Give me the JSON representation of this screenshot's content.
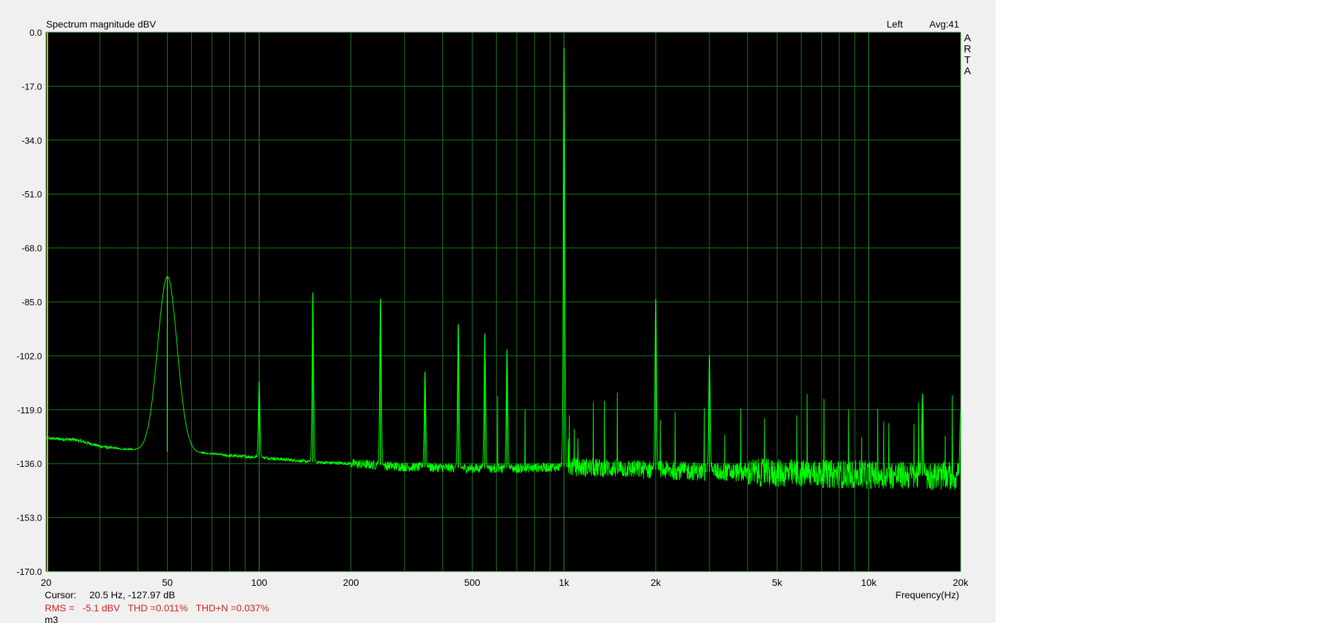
{
  "chart_data": {
    "type": "line",
    "title": "Spectrum magnitude dBV",
    "channel_label": "Left",
    "avg_label": "Avg:41",
    "brand": "ARTA",
    "xlabel": "Frequency(Hz)",
    "xscale": "log",
    "xlim": [
      20,
      20000
    ],
    "ylim": [
      -170,
      0
    ],
    "yticks": [
      0,
      -17,
      -34,
      -51,
      -68,
      -85,
      -102,
      -119,
      -136,
      -153,
      -170
    ],
    "ytick_labels": [
      "0.0",
      "-17.0",
      "-34.0",
      "-51.0",
      "-68.0",
      "-85.0",
      "-102.0",
      "-119.0",
      "-136.0",
      "-153.0",
      "-170.0"
    ],
    "xticks": [
      20,
      50,
      100,
      200,
      500,
      1000,
      2000,
      5000,
      10000,
      20000
    ],
    "xtick_labels": [
      "20",
      "50",
      "100",
      "200",
      "500",
      "1k",
      "2k",
      "5k",
      "10k",
      "20k"
    ],
    "grid": true,
    "series_color": "#00ff00",
    "background_color": "#000000",
    "grid_color": "#1f7a1f",
    "noise_floor": [
      [
        20,
        -128
      ],
      [
        25,
        -128.5
      ],
      [
        30,
        -130.5
      ],
      [
        35,
        -131.5
      ],
      [
        45,
        -132
      ],
      [
        60,
        -132.5
      ],
      [
        80,
        -133.5
      ],
      [
        100,
        -134
      ],
      [
        150,
        -135.5
      ],
      [
        200,
        -136
      ],
      [
        300,
        -137
      ],
      [
        500,
        -137.5
      ],
      [
        700,
        -137.5
      ],
      [
        1000,
        -137
      ],
      [
        1500,
        -137.5
      ],
      [
        2000,
        -138
      ],
      [
        3000,
        -138.5
      ],
      [
        5000,
        -139
      ],
      [
        10000,
        -139.5
      ],
      [
        20000,
        -140
      ]
    ],
    "peaks": [
      {
        "f": 50,
        "db": -77
      },
      {
        "f": 100,
        "db": -110
      },
      {
        "f": 150,
        "db": -82
      },
      {
        "f": 250,
        "db": -84
      },
      {
        "f": 350,
        "db": -107
      },
      {
        "f": 450,
        "db": -92
      },
      {
        "f": 550,
        "db": -95
      },
      {
        "f": 650,
        "db": -100
      },
      {
        "f": 1000,
        "db": -5
      },
      {
        "f": 2000,
        "db": -84
      },
      {
        "f": 3000,
        "db": -102
      },
      {
        "f": 15000,
        "db": -114
      },
      {
        "f": 20000,
        "db": -119
      }
    ]
  },
  "footer": {
    "cursor_label": "Cursor:",
    "cursor_value": "20.5 Hz, -127.97 dB",
    "rms_line": "RMS =   -5.1 dBV   THD =0.011%   THD+N =0.037%",
    "file_name": "m3",
    "stats_color": "#d42020"
  }
}
